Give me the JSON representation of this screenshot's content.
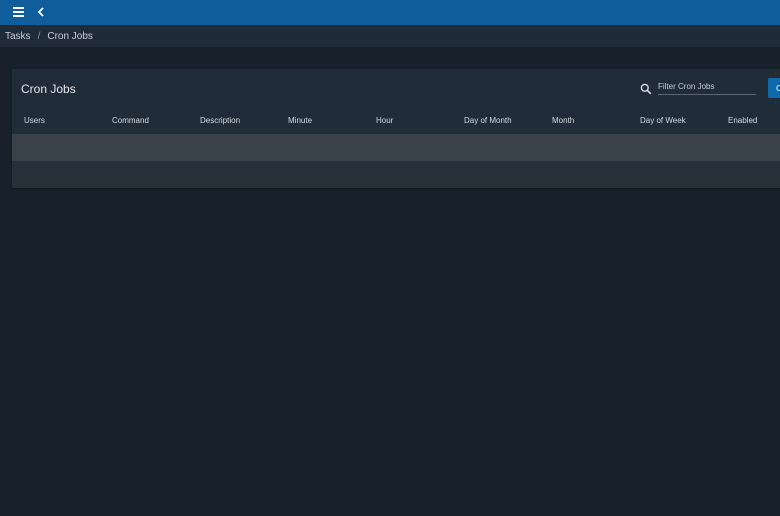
{
  "topbar": {
    "menu_icon": "hamburger-menu-icon",
    "back_icon": "chevron-left-icon",
    "color": "#0f5d9a"
  },
  "breadcrumb": {
    "items": [
      "Tasks",
      "Cron Jobs"
    ],
    "separator": "/"
  },
  "card": {
    "title": "Cron Jobs",
    "filter": {
      "placeholder": "Filter Cron Jobs",
      "value": "",
      "icon": "search-icon"
    },
    "add_button_label": "C",
    "columns": [
      "Users",
      "Command",
      "Description",
      "Minute",
      "Hour",
      "Day of Month",
      "Month",
      "Day of Week",
      "Enabled"
    ],
    "rows": []
  },
  "colors": {
    "background": "#18212b",
    "card": "#202c37",
    "accent": "#0f69ad"
  }
}
